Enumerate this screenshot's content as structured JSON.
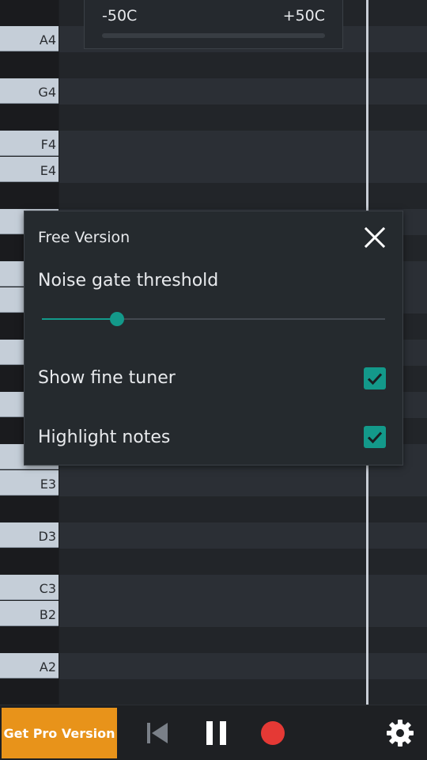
{
  "fine_tuner": {
    "min_label": "-50C",
    "max_label": "+50C"
  },
  "keyboard": {
    "rows": [
      {
        "type": "black",
        "label": ""
      },
      {
        "type": "white",
        "label": "A4"
      },
      {
        "type": "black",
        "label": ""
      },
      {
        "type": "white",
        "label": "G4"
      },
      {
        "type": "black",
        "label": ""
      },
      {
        "type": "white",
        "label": "F4"
      },
      {
        "type": "white",
        "label": "E4"
      },
      {
        "type": "black",
        "label": ""
      },
      {
        "type": "white",
        "label": ""
      },
      {
        "type": "black",
        "label": ""
      },
      {
        "type": "white",
        "label": ""
      },
      {
        "type": "white",
        "label": ""
      },
      {
        "type": "black",
        "label": ""
      },
      {
        "type": "white",
        "label": ""
      },
      {
        "type": "black",
        "label": ""
      },
      {
        "type": "white",
        "label": ""
      },
      {
        "type": "black",
        "label": ""
      },
      {
        "type": "white",
        "label": ""
      },
      {
        "type": "white",
        "label": "E3"
      },
      {
        "type": "black",
        "label": ""
      },
      {
        "type": "white",
        "label": "D3"
      },
      {
        "type": "black",
        "label": ""
      },
      {
        "type": "white",
        "label": "C3"
      },
      {
        "type": "white",
        "label": "B2"
      },
      {
        "type": "black",
        "label": ""
      },
      {
        "type": "white",
        "label": "A2"
      },
      {
        "type": "black",
        "label": ""
      }
    ]
  },
  "dialog": {
    "title": "Free Version",
    "noise_gate_label": "Noise gate threshold",
    "noise_gate_value": 0.2,
    "show_fine_tuner_label": "Show fine tuner",
    "show_fine_tuner_checked": true,
    "highlight_notes_label": "Highlight notes",
    "highlight_notes_checked": true
  },
  "bottom_bar": {
    "pro_label": "Get Pro Version"
  },
  "icons": {
    "close": "close-icon",
    "rewind": "skip-to-start-icon",
    "pause": "pause-icon",
    "record": "record-icon",
    "settings": "gear-icon"
  },
  "colors": {
    "accent": "#13998a",
    "pro_button": "#e8931a",
    "record": "#e53935"
  }
}
